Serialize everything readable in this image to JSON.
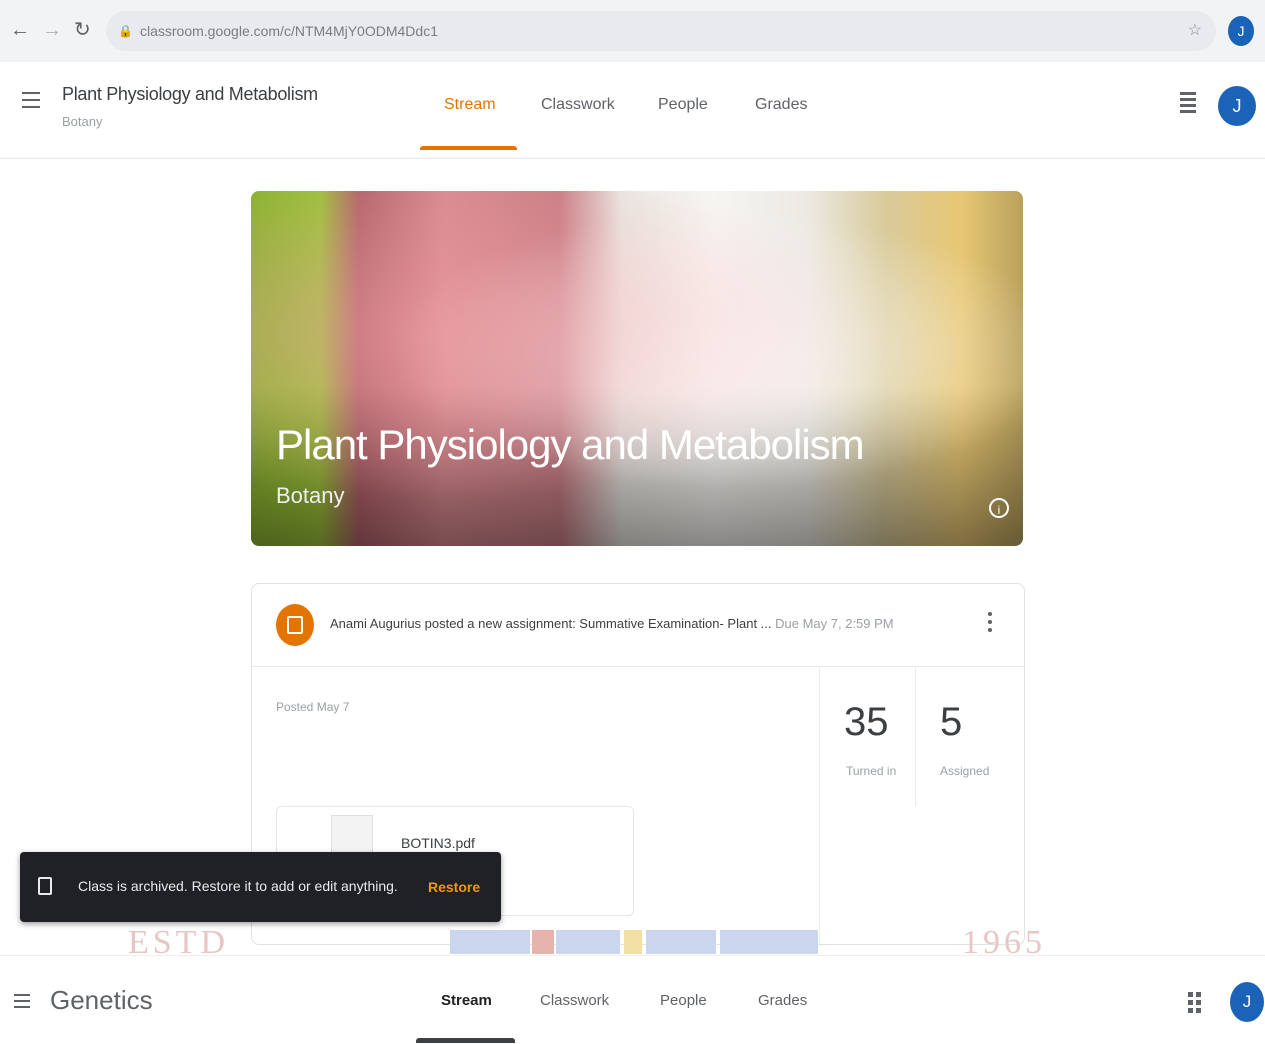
{
  "browser": {
    "url": "classroom.google.com/c/NTM4MjY0ODM4Ddc1",
    "profile_initial": "J"
  },
  "classroom": {
    "title": "Plant Physiology and Metabolism",
    "section": "Botany",
    "tabs": [
      {
        "label": "Stream",
        "active": true
      },
      {
        "label": "Classwork",
        "active": false
      },
      {
        "label": "People",
        "active": false
      },
      {
        "label": "Grades",
        "active": false
      }
    ],
    "avatar_initial": "J",
    "accent_color": "#e37400"
  },
  "banner": {
    "title": "Plant Physiology and Metabolism",
    "subtitle": "Botany"
  },
  "post": {
    "text": "Anami Augurius posted a new assignment: Summative Examination- Plant ...",
    "date": "Due May 7, 2:59 PM",
    "posted": "Posted May 7",
    "turned_in_count": "35",
    "turned_in_label": "Turned in",
    "assigned_count": "5",
    "assigned_label": "Assigned",
    "attachment_name": "BOTIN3.pdf"
  },
  "snackbar": {
    "message": "Class is archived. Restore it to add or edit anything.",
    "action": "Restore"
  },
  "decor": {
    "left_text": "ESTD",
    "right_text": "1965"
  },
  "classroom2": {
    "title": "Genetics",
    "tabs": [
      {
        "label": "Stream",
        "active": true
      },
      {
        "label": "Classwork",
        "active": false
      },
      {
        "label": "People",
        "active": false
      },
      {
        "label": "Grades",
        "active": false
      }
    ],
    "avatar_initial": "J"
  }
}
